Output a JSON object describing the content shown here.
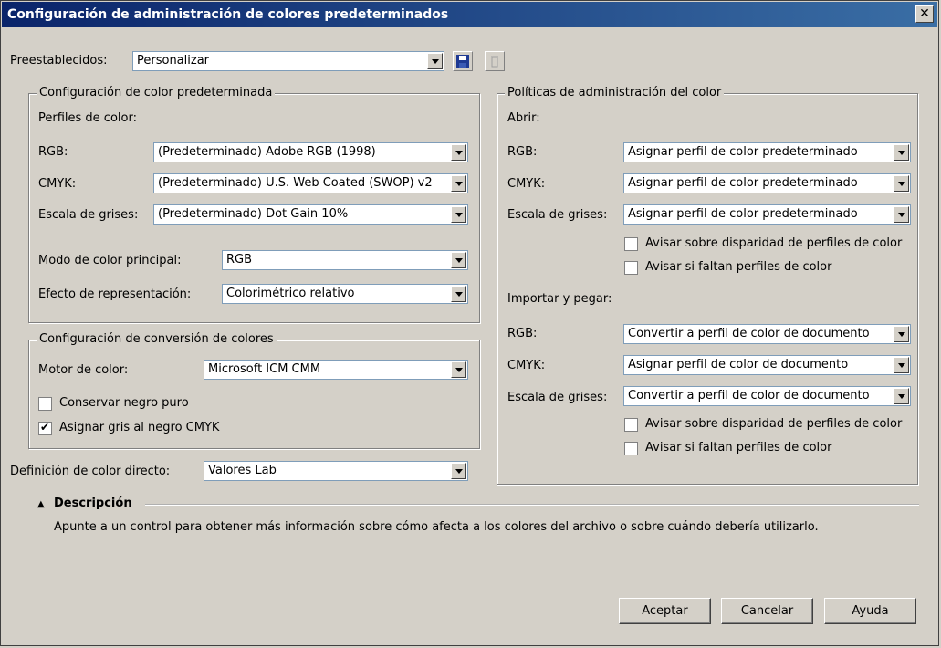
{
  "window": {
    "title": "Configuración de administración de colores predeterminados",
    "close_label": "✕"
  },
  "presets": {
    "label": "Preestablecidos:",
    "value": "Personalizar"
  },
  "default_color": {
    "legend": "Configuración de color predeterminada",
    "profiles_label": "Perfiles de color:",
    "rgb_label": "RGB:",
    "rgb_value": "(Predeterminado) Adobe RGB (1998)",
    "cmyk_label": "CMYK:",
    "cmyk_value": "(Predeterminado) U.S. Web Coated (SWOP) v2",
    "gray_label": "Escala de grises:",
    "gray_value": "(Predeterminado) Dot Gain 10%",
    "mode_label": "Modo de color principal:",
    "mode_value": "RGB",
    "intent_label": "Efecto de representación:",
    "intent_value": "Colorimétrico relativo"
  },
  "conversion": {
    "legend": "Configuración de conversión de colores",
    "engine_label": "Motor de color:",
    "engine_value": "Microsoft ICM CMM",
    "preserve_black_label": "Conservar negro puro",
    "preserve_black_checked": false,
    "map_gray_label": "Asignar gris al negro CMYK",
    "map_gray_checked": true
  },
  "spot": {
    "label": "Definición de color directo:",
    "value": "Valores Lab"
  },
  "policies": {
    "legend": "Políticas de administración del color",
    "open_label": "Abrir:",
    "open_rgb_label": "RGB:",
    "open_rgb_value": "Asignar perfil de color predeterminado",
    "open_cmyk_label": "CMYK:",
    "open_cmyk_value": "Asignar perfil de color predeterminado",
    "open_gray_label": "Escala de grises:",
    "open_gray_value": "Asignar perfil de color predeterminado",
    "open_warn_mismatch": "Avisar sobre disparidad de perfiles de color",
    "open_warn_missing": "Avisar si faltan perfiles de color",
    "import_label": "Importar y pegar:",
    "imp_rgb_label": "RGB:",
    "imp_rgb_value": "Convertir a perfil de color de documento",
    "imp_cmyk_label": "CMYK:",
    "imp_cmyk_value": "Asignar perfil de color de documento",
    "imp_gray_label": "Escala de grises:",
    "imp_gray_value": "Convertir a perfil de color de documento",
    "imp_warn_mismatch": "Avisar sobre disparidad de perfiles de color",
    "imp_warn_missing": "Avisar si faltan perfiles de color"
  },
  "description": {
    "toggle": "▲",
    "title": "Descripción",
    "text": "Apunte a un control para obtener más información sobre cómo afecta a los colores del archivo o sobre cuándo debería utilizarlo."
  },
  "buttons": {
    "ok": "Aceptar",
    "cancel": "Cancelar",
    "help": "Ayuda"
  }
}
